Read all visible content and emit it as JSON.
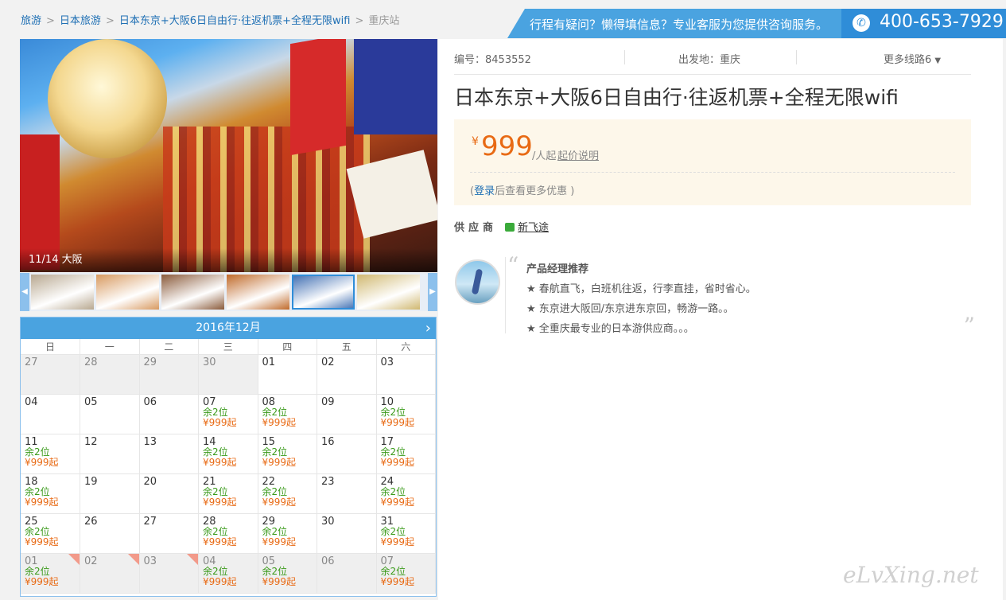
{
  "breadcrumb": {
    "items": [
      "旅游",
      "日本旅游",
      "日本东京+大阪6日自由行·往返机票+全程无限wifi"
    ],
    "current": "重庆站",
    "separator": ">"
  },
  "banner": {
    "message": "行程有疑问？懒得填信息？专业客服为您提供咨询服务。",
    "phone": "400-653-7929"
  },
  "gallery": {
    "caption": "11/14 大阪",
    "thumbs": [
      {
        "name": "thumb-1",
        "color": "#b8a890"
      },
      {
        "name": "thumb-2",
        "color": "#d89a60"
      },
      {
        "name": "thumb-3",
        "color": "#8a5a3a"
      },
      {
        "name": "thumb-4",
        "color": "#c06a2a"
      },
      {
        "name": "thumb-5",
        "color": "#3a6ab0"
      },
      {
        "name": "thumb-6",
        "color": "#d0b870"
      }
    ]
  },
  "calendar": {
    "month": "2016年12月",
    "weekdays": [
      "日",
      "一",
      "二",
      "三",
      "四",
      "五",
      "六"
    ],
    "rows": [
      [
        {
          "d": "27",
          "g": 1
        },
        {
          "d": "28",
          "g": 1
        },
        {
          "d": "29",
          "g": 1
        },
        {
          "d": "30",
          "g": 1
        },
        {
          "d": "01"
        },
        {
          "d": "02"
        },
        {
          "d": "03"
        }
      ],
      [
        {
          "d": "04"
        },
        {
          "d": "05"
        },
        {
          "d": "06"
        },
        {
          "d": "07",
          "s": "余2位",
          "p": "¥999起"
        },
        {
          "d": "08",
          "s": "余2位",
          "p": "¥999起"
        },
        {
          "d": "09"
        },
        {
          "d": "10",
          "s": "余2位",
          "p": "¥999起"
        }
      ],
      [
        {
          "d": "11",
          "s": "余2位",
          "p": "¥999起"
        },
        {
          "d": "12"
        },
        {
          "d": "13"
        },
        {
          "d": "14",
          "s": "余2位",
          "p": "¥999起"
        },
        {
          "d": "15",
          "s": "余2位",
          "p": "¥999起"
        },
        {
          "d": "16"
        },
        {
          "d": "17",
          "s": "余2位",
          "p": "¥999起"
        }
      ],
      [
        {
          "d": "18",
          "s": "余2位",
          "p": "¥999起"
        },
        {
          "d": "19"
        },
        {
          "d": "20"
        },
        {
          "d": "21",
          "s": "余2位",
          "p": "¥999起"
        },
        {
          "d": "22",
          "s": "余2位",
          "p": "¥999起"
        },
        {
          "d": "23"
        },
        {
          "d": "24",
          "s": "余2位",
          "p": "¥999起"
        }
      ],
      [
        {
          "d": "25",
          "s": "余2位",
          "p": "¥999起"
        },
        {
          "d": "26"
        },
        {
          "d": "27"
        },
        {
          "d": "28",
          "s": "余2位",
          "p": "¥999起"
        },
        {
          "d": "29",
          "s": "余2位",
          "p": "¥999起"
        },
        {
          "d": "30"
        },
        {
          "d": "31",
          "s": "余2位",
          "p": "¥999起"
        }
      ],
      [
        {
          "d": "01",
          "g": 1,
          "c": 1,
          "s": "余2位",
          "p": "¥999起"
        },
        {
          "d": "02",
          "g": 1,
          "c": 1
        },
        {
          "d": "03",
          "g": 1,
          "c": 1
        },
        {
          "d": "04",
          "g": 1,
          "s": "余2位",
          "p": "¥999起"
        },
        {
          "d": "05",
          "g": 1,
          "s": "余2位",
          "p": "¥999起"
        },
        {
          "d": "06",
          "g": 1
        },
        {
          "d": "07",
          "g": 1,
          "s": "余2位",
          "p": "¥999起"
        }
      ]
    ]
  },
  "product": {
    "code": "编号：8453552",
    "departure": "出发地：重庆",
    "more_routes": "更多线路6",
    "title": "日本东京+大阪6日自由行·往返机票+全程无限wifi",
    "currency": "¥",
    "price": "999",
    "unit": "/人起",
    "price_explain": "起价说明",
    "login_prefix": "(",
    "login_link": "登录",
    "login_suffix": "后查看更多优惠 )",
    "supplier_label": "供应商",
    "supplier_name": "新飞途"
  },
  "recommend": {
    "heading": "产品经理推荐",
    "items": [
      "★ 春航直飞，白班机往返，行李直挂，省时省心。",
      "★ 东京进大阪回/东京进东京回，畅游一路。。",
      "★ 全重庆最专业的日本游供应商。。。"
    ]
  },
  "watermark": "eLvXing.net"
}
